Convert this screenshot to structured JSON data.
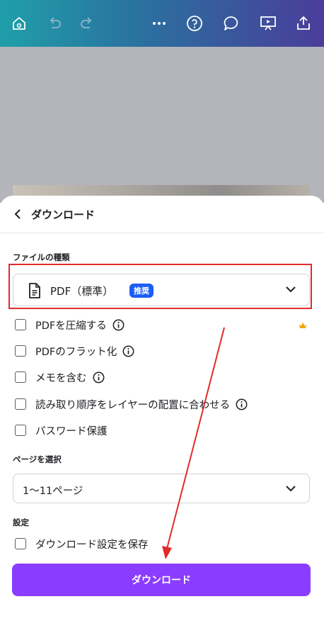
{
  "toolbar": {
    "icons": [
      "home-icon",
      "undo-icon",
      "redo-icon",
      "more-icon",
      "help-icon",
      "comment-icon",
      "present-icon",
      "share-icon"
    ]
  },
  "sheet": {
    "title": "ダウンロード",
    "file_type_label": "ファイルの種類",
    "file_type_value": "PDF（標準）",
    "recommended_badge": "推奨",
    "options": [
      {
        "label": "PDFを圧縮する",
        "checked": false,
        "info": true,
        "premium": true
      },
      {
        "label": "PDFのフラット化",
        "checked": false,
        "info": true
      },
      {
        "label": "メモを含む",
        "checked": false,
        "info": true
      },
      {
        "label": "読み取り順序をレイヤーの配置に合わせる",
        "checked": false,
        "info": true
      },
      {
        "label": "パスワード保護",
        "checked": false,
        "info": false
      }
    ],
    "pages_label": "ページを選択",
    "pages_value": "1〜11ページ",
    "settings_label": "設定",
    "save_settings_label": "ダウンロード設定を保存",
    "download_button": "ダウンロード"
  },
  "colors": {
    "accent": "#8b3dff",
    "badge": "#1c5df5",
    "highlight": "#e32a2a",
    "crown": "#f0a500"
  }
}
